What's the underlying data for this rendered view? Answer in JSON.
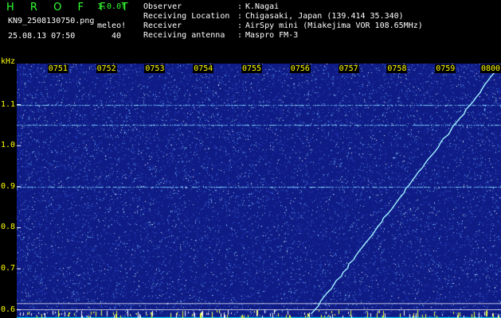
{
  "header": {
    "software": "H R O F F T",
    "version": "1.0.0f",
    "filename": "KN9_2508130750.png",
    "datetime": "25.08.13 07:50",
    "meleo_label": "meleo!",
    "meleo_value": "40",
    "info": [
      {
        "key": "Observer",
        "value": "K.Nagai"
      },
      {
        "key": "Receiving Location",
        "value": "Chigasaki, Japan (139.414 35.340)"
      },
      {
        "key": "Receiver",
        "value": "AirSpy mini (Miakejima VOR 108.65MHz)"
      },
      {
        "key": "Receiving antenna",
        "value": "Maspro FM-3"
      }
    ],
    "separator": ":"
  },
  "colors": {
    "background": "#101c86",
    "signal": "#9ff0ff",
    "tick_text": "#ffff00",
    "header_green": "#33ff33",
    "bottom_band": "#00e5ff"
  },
  "chart_data": {
    "type": "heatmap",
    "ylabel": "kHz",
    "xlabel": "",
    "title": "",
    "x_ticks": [
      "0751",
      "0752",
      "0753",
      "0754",
      "0755",
      "0756",
      "0757",
      "0758",
      "0759",
      "0800"
    ],
    "y_ticks": [
      "1.1",
      "1.0",
      "0.9",
      "0.8",
      "0.7",
      "0.6"
    ],
    "x_range_minutes": [
      50,
      60
    ],
    "y_range_khz": [
      0.58,
      1.2
    ],
    "horizontal_bands_khz": [
      1.1,
      1.05,
      0.9
    ],
    "meteor_trace": {
      "start": {
        "time_min": 56.1,
        "freq_khz": 0.59
      },
      "end": {
        "time_min": 60.0,
        "freq_khz": 1.2
      }
    },
    "grid": false
  }
}
